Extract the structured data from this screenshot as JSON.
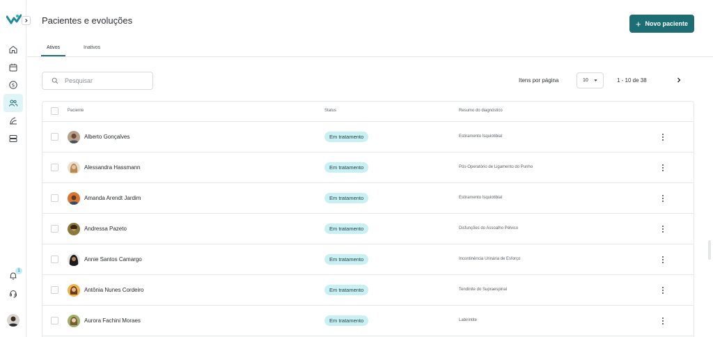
{
  "header": {
    "title": "Pacientes e evoluções",
    "new_button_label": "Novo paciente"
  },
  "tabs": [
    {
      "label": "Ativos",
      "active": true
    },
    {
      "label": "Inativos",
      "active": false
    }
  ],
  "search": {
    "placeholder": "Pesquisar",
    "value": ""
  },
  "pagination": {
    "per_page_label": "Itens por página",
    "per_page_value": "10",
    "range_text": "1 - 10 de 38"
  },
  "table": {
    "columns": [
      "Paciente",
      "Status",
      "Resumo do diagnóstico"
    ],
    "rows": [
      {
        "name": "Alberto Gonçalves",
        "status": "Em tratamento",
        "diagnosis": "Estiramento Isquiotibial"
      },
      {
        "name": "Alessandra Hassmann",
        "status": "Em tratamento",
        "diagnosis": "Pós-Operatório de Ligamento do Punho"
      },
      {
        "name": "Amanda Arendt Jardim",
        "status": "Em tratamento",
        "diagnosis": "Estiramento Isquiotibial"
      },
      {
        "name": "Andressa Pazeto",
        "status": "Em tratamento",
        "diagnosis": "Disfunções do Assoalho Pélvico"
      },
      {
        "name": "Annie Santos Camargo",
        "status": "Em tratamento",
        "diagnosis": "Incontinência Urinária de Esforço"
      },
      {
        "name": "Antônia Nunes Cordeiro",
        "status": "Em tratamento",
        "diagnosis": "Tendinite do Supraespinal"
      },
      {
        "name": "Aurora Fachini Moraes",
        "status": "Em tratamento",
        "diagnosis": "Labirintite"
      }
    ]
  },
  "sidebar": {
    "notification_count": "1",
    "items": [
      {
        "icon": "home-icon"
      },
      {
        "icon": "calendar-icon"
      },
      {
        "icon": "dollar-coin-icon"
      },
      {
        "icon": "users-icon",
        "active": true
      },
      {
        "icon": "evolution-icon"
      },
      {
        "icon": "storage-icon"
      }
    ]
  },
  "colors": {
    "primary": "#1d6d75",
    "status_badge_bg": "#c9f0f3",
    "active_nav_bg": "#dff4f6"
  }
}
